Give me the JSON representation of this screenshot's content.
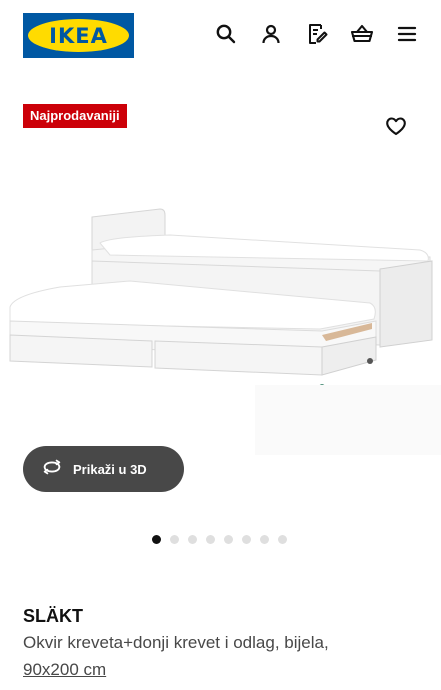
{
  "header": {
    "logo_text": "IKEA",
    "icons": [
      "search-icon",
      "account-icon",
      "shopping-list-icon",
      "basket-icon",
      "menu-icon"
    ]
  },
  "product": {
    "badge": "Najprodavaniji",
    "name": "SLÄKT",
    "description": "Okvir kreveta+donji krevet i odlag, bijela,",
    "size": "90x200 cm"
  },
  "gallery": {
    "view3d_label": "Prikaži u 3D",
    "image_count": 8,
    "active_index": 0
  },
  "colors": {
    "brand_blue": "#0058a3",
    "brand_yellow": "#ffdb00",
    "badge_red": "#cc0008",
    "button_dark": "#484848"
  }
}
